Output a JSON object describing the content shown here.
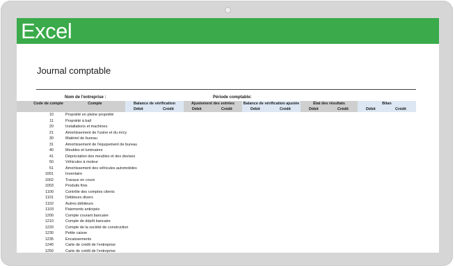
{
  "banner": {
    "title": "Excel"
  },
  "document": {
    "title": "Journal comptable"
  },
  "labels": {
    "company": "Nom de l'entreprise :",
    "period": "Période comptable:"
  },
  "columns": {
    "code": "Code de compte",
    "account": "Compte",
    "groups": [
      "Balance de vérification",
      "Ajustement des entrées",
      "Balance de vérification ajustée",
      "État des résultats",
      "Bilan"
    ],
    "debit": "Débit",
    "credit": "Crédit"
  },
  "rows": [
    {
      "code": "10",
      "name": "Propriété en pleine propriété"
    },
    {
      "code": "11",
      "name": "Propriété à bail"
    },
    {
      "code": "20",
      "name": "Installations et machines"
    },
    {
      "code": "21",
      "name": "Amortissement de l'usine et du m/cy"
    },
    {
      "code": "30",
      "name": "Matériel de bureau"
    },
    {
      "code": "31",
      "name": "Amortissement de l'équipement de bureau"
    },
    {
      "code": "40",
      "name": "Meubles et luminaires"
    },
    {
      "code": "41",
      "name": "Dépréciation des meubles et des devises"
    },
    {
      "code": "50",
      "name": "Véhicules à moteur"
    },
    {
      "code": "51",
      "name": "Amortissement des véhicules automobiles"
    },
    {
      "code": "1001",
      "name": "Inventaire"
    },
    {
      "code": "1002",
      "name": "Travaux en cours"
    },
    {
      "code": "1003",
      "name": "Produits finis"
    },
    {
      "code": "1100",
      "name": "Contrôle des comptes clients"
    },
    {
      "code": "1101",
      "name": "Débiteurs divers"
    },
    {
      "code": "1102",
      "name": "Autres débiteurs"
    },
    {
      "code": "1103",
      "name": "Paiements anticipés"
    },
    {
      "code": "1200",
      "name": "Compte courant bancaire"
    },
    {
      "code": "1210",
      "name": "Compte de dépôt bancaire"
    },
    {
      "code": "1220",
      "name": "Compte de la société de construction"
    },
    {
      "code": "1230",
      "name": "Petite caisse"
    },
    {
      "code": "1235",
      "name": "Encaissements"
    },
    {
      "code": "1240",
      "name": "Carte de crédit de l'entreprise"
    },
    {
      "code": "1250",
      "name": "Carte de crédit de l'entreprise"
    }
  ]
}
